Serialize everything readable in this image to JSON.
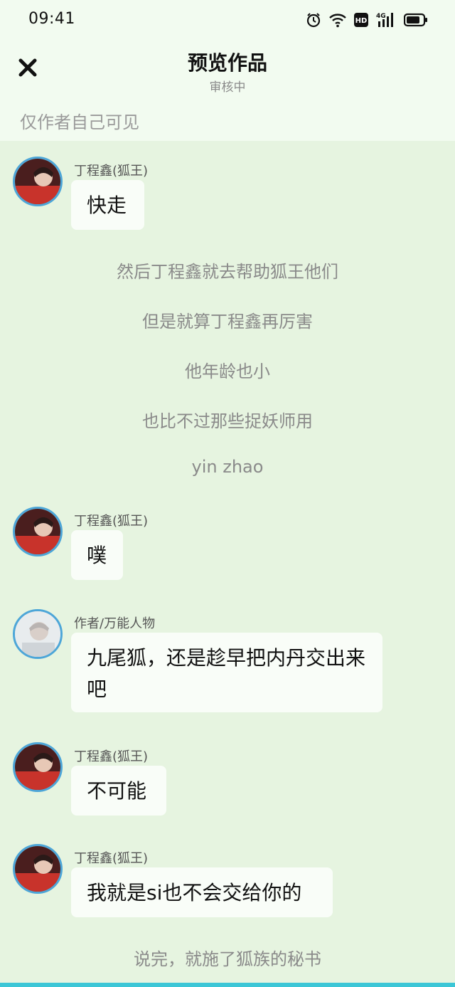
{
  "status_bar": {
    "time": "09:41",
    "icons": [
      "alarm-icon",
      "wifi-icon",
      "hd-icon",
      "signal-4g-icon",
      "battery-icon"
    ],
    "network_label": "4G",
    "hd_label": "HD"
  },
  "header": {
    "title": "预览作品",
    "subtitle": "审核中",
    "notice": "仅作者自己可见",
    "close_icon": "close-icon"
  },
  "messages": [
    {
      "type": "bubble",
      "sender": "丁程鑫(狐王)",
      "text": "快走"
    },
    {
      "type": "narration",
      "text": "然后丁程鑫就去帮助狐王他们"
    },
    {
      "type": "narration",
      "text": "但是就算丁程鑫再厉害"
    },
    {
      "type": "narration",
      "text": "他年龄也小"
    },
    {
      "type": "narration",
      "text": "也比不过那些捉妖师用"
    },
    {
      "type": "narration",
      "text": "yin zhao"
    },
    {
      "type": "bubble",
      "sender": "丁程鑫(狐王)",
      "text": "噗"
    },
    {
      "type": "bubble",
      "sender": "作者/万能人物",
      "text": "九尾狐，还是趁早把内丹交出来吧"
    },
    {
      "type": "bubble",
      "sender": "丁程鑫(狐王)",
      "text": "不可能"
    },
    {
      "type": "bubble",
      "sender": "丁程鑫(狐王)",
      "text": "我就是si也不会交给你的"
    },
    {
      "type": "narration",
      "text": "说完，就施了狐族的秘书"
    }
  ],
  "colors": {
    "chat_background": "#e6f4e0",
    "bubble_background": "#f9fdf8",
    "avatar_ring": "#4da6d8",
    "bottom_bar": "#3cc6d6"
  }
}
